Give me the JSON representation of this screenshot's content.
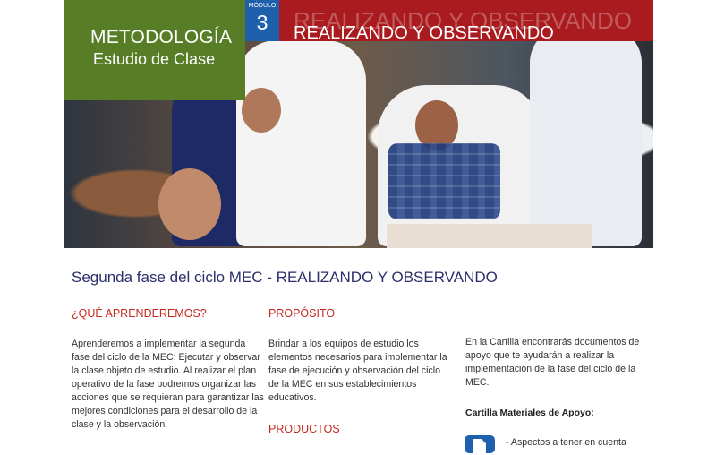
{
  "hero": {
    "badge_title": "METODOLOGÍA",
    "badge_subtitle": "Estudio de Clase",
    "module_label": "MÓDULO",
    "module_number": "3",
    "phase_ghost": "REALIZANDO Y OBSERVANDO",
    "phase_title": "REALIZANDO Y OBSERVANDO"
  },
  "main": {
    "title": "Segunda fase del ciclo MEC - REALIZANDO Y OBSERVANDO",
    "learn_heading": "¿QUÉ APRENDEREMOS?",
    "learn_text": "Aprenderemos a implementar la segunda fase del ciclo de la MEC: Ejecutar y observar la clase objeto de estudio. Al realizar el plan operativo de la fase podremos organizar las acciones que se requieran para garantizar las mejores condiciones para el desarrollo de la clase y la observación.",
    "purpose_heading": "PROPÓSITO",
    "purpose_text": "Brindar a los equipos de estudio los elementos necesarios para implementar la fase de ejecución y observación del ciclo de la MEC en sus establecimientos educativos.",
    "products_heading": "PRODUCTOS",
    "card_text": "En la Cartilla encontrarás documentos de apoyo que te ayudarán a realizar la implementación de la fase del ciclo de la MEC.",
    "materials_title": "Cartilla Materiales de Apoyo:",
    "material_item": "- Aspectos a tener en cuenta"
  }
}
